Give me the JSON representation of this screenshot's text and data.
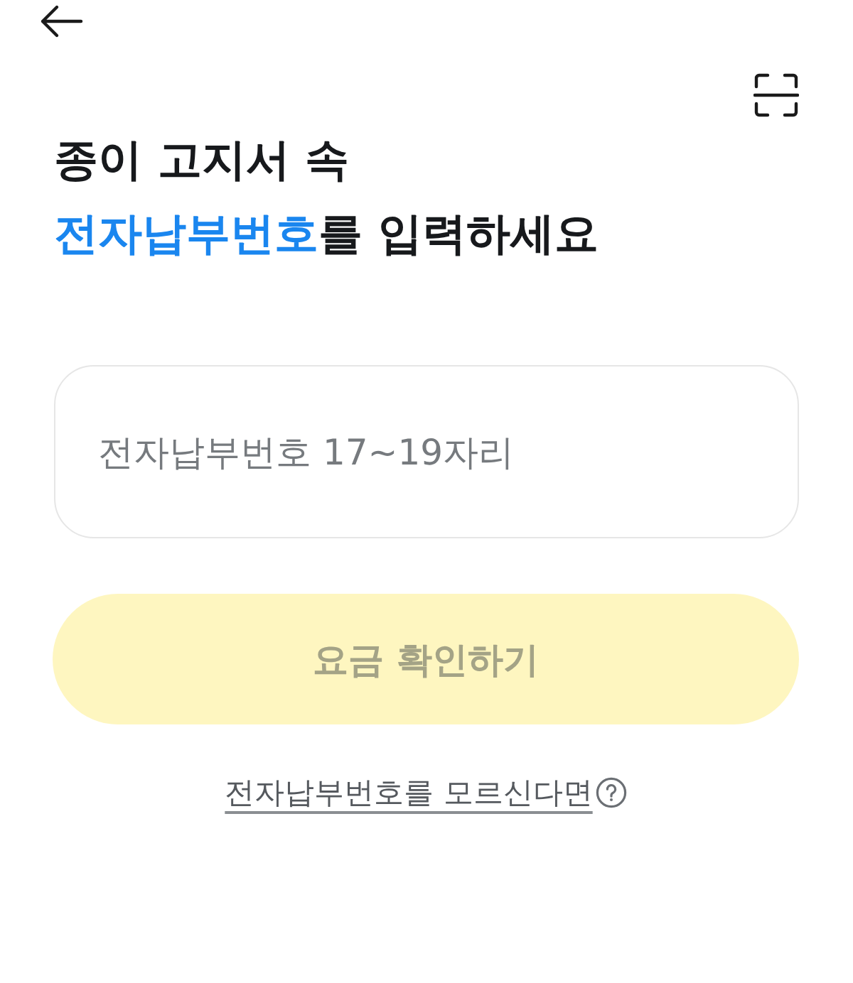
{
  "title": {
    "lines": [
      [
        {
          "text": "종이 고지서 속",
          "highlight": false
        }
      ],
      [
        {
          "text": "전자납부번호",
          "highlight": true
        },
        {
          "text": "를 입력하세요",
          "highlight": false
        }
      ]
    ]
  },
  "input": {
    "placeholder": "전자납부번호 17~19자리"
  },
  "submit_button": {
    "label": "요금 확인하기",
    "disabled": true
  },
  "help_link": {
    "label": "전자납부번호를 모르신다면"
  }
}
